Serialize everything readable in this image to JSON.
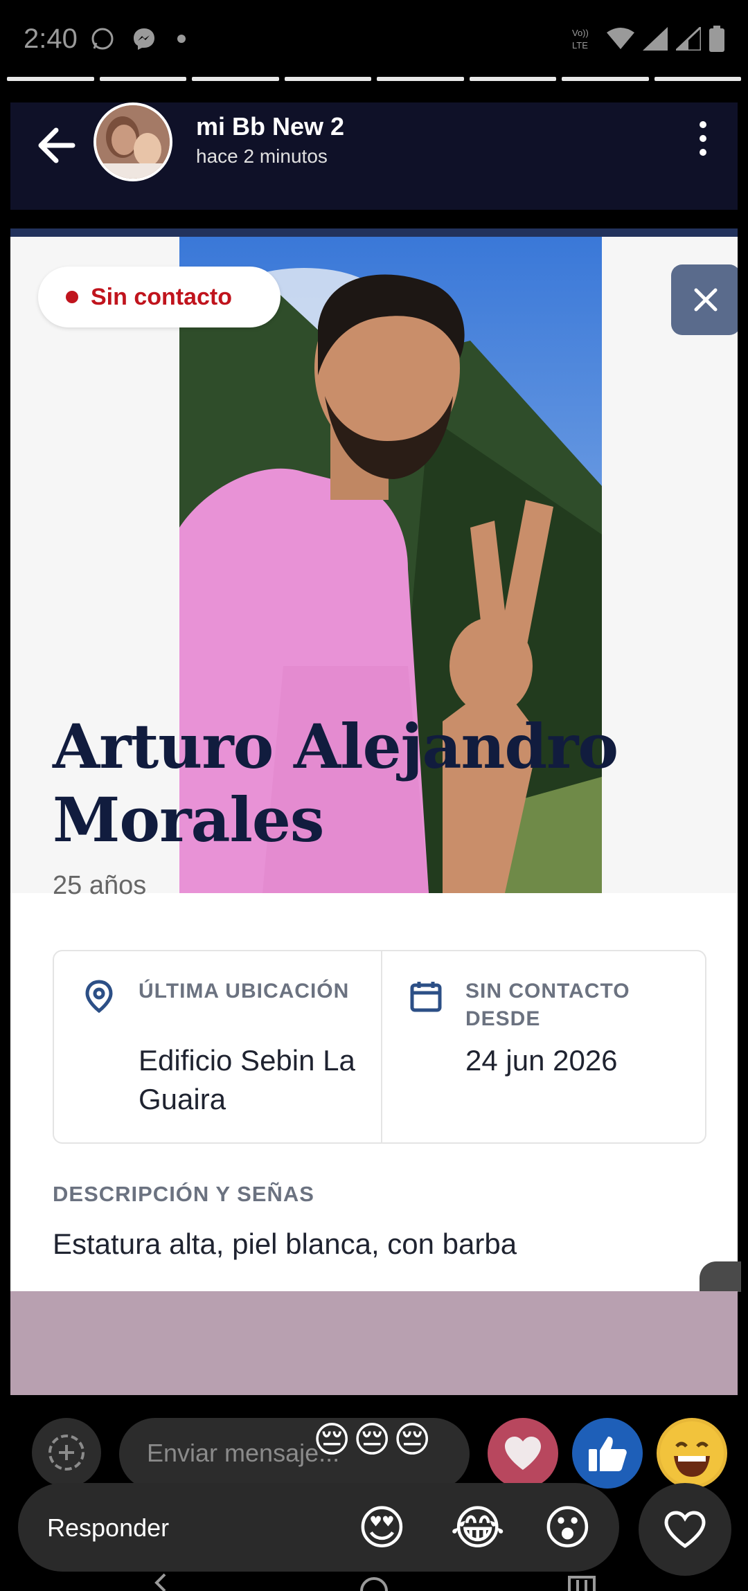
{
  "status_bar": {
    "time": "2:40",
    "left_icons": [
      "whatsapp-icon",
      "messenger-icon",
      "dot-icon"
    ],
    "right_icons": [
      "volte-lte-icon",
      "wifi-icon",
      "signal-icon",
      "signal-icon",
      "battery-icon"
    ],
    "volte_text": "Vo)) LTE"
  },
  "story": {
    "progress_segments": 8,
    "author": "mi Bb New 2",
    "posted": "hace 2 minutos"
  },
  "card": {
    "status_pill": "Sin contacto",
    "status_color": "#c0141d",
    "name": "Arturo Alejandro Morales",
    "age": "25 años",
    "last_location_label": "ÚLTIMA UBICACIÓN",
    "last_location_value": "Edificio Sebin La Guaira",
    "no_contact_label": "SIN CONTACTO DESDE",
    "no_contact_value": "24 jun 2026",
    "description_label": "DESCRIPCIÓN Y SEÑAS",
    "description_value": "Estatura alta, piel blanca, con barba",
    "accent_color": "#111c3e"
  },
  "compose": {
    "placeholder": "Enviar mensaje...",
    "mini_emojis": [
      "😔",
      "😔",
      "😔"
    ],
    "reactions": [
      "heart",
      "like",
      "laugh"
    ],
    "reply_label": "Responder",
    "reply_emojis": [
      "😍",
      "😂",
      "😮"
    ]
  }
}
